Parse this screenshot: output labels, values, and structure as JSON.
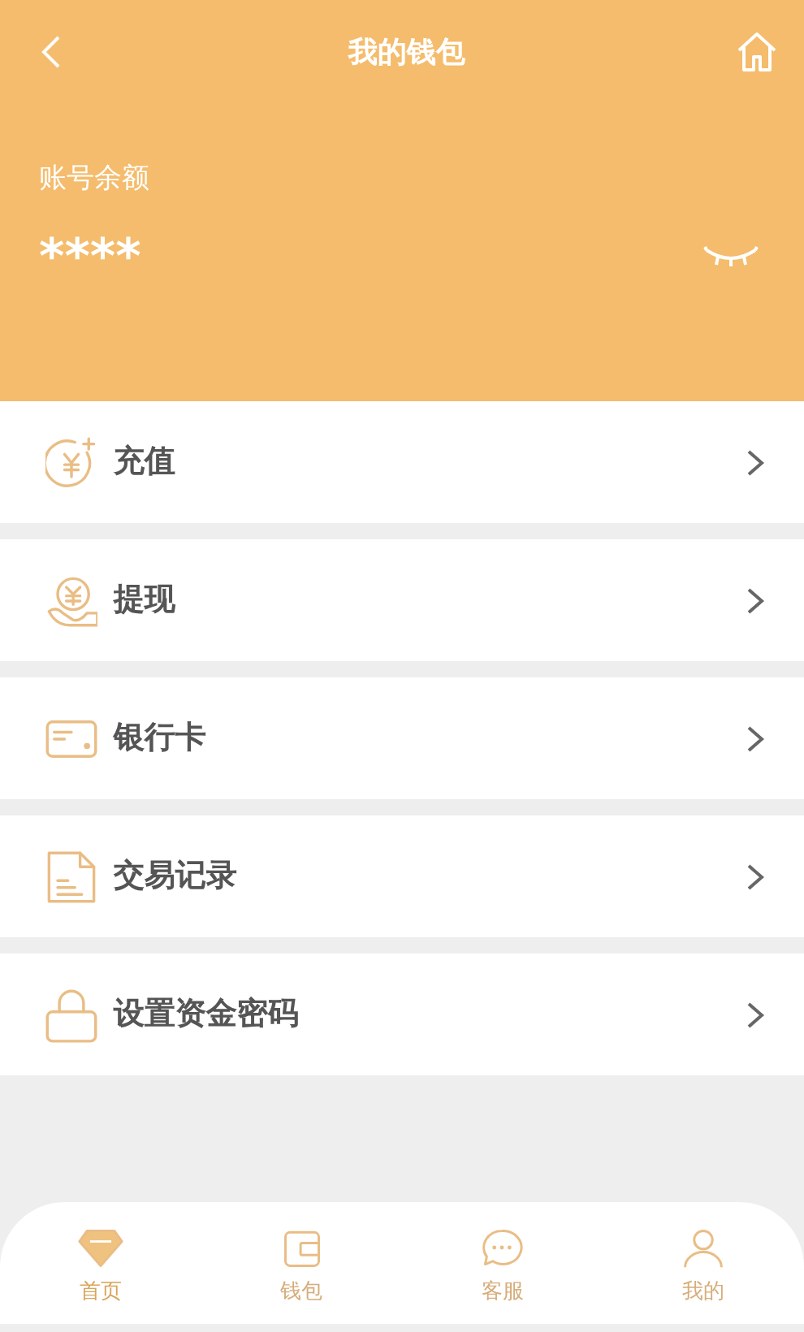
{
  "header": {
    "title": "我的钱包"
  },
  "balance": {
    "label": "账号余额",
    "value": "****",
    "hidden": true
  },
  "menu": [
    {
      "label": "充值"
    },
    {
      "label": "提现"
    },
    {
      "label": "银行卡"
    },
    {
      "label": "交易记录"
    },
    {
      "label": "设置资金密码"
    }
  ],
  "bottom_nav": [
    {
      "label": "首页",
      "selected": true
    },
    {
      "label": "钱包",
      "selected": false
    },
    {
      "label": "客服",
      "selected": false
    },
    {
      "label": "我的",
      "selected": false
    }
  ]
}
